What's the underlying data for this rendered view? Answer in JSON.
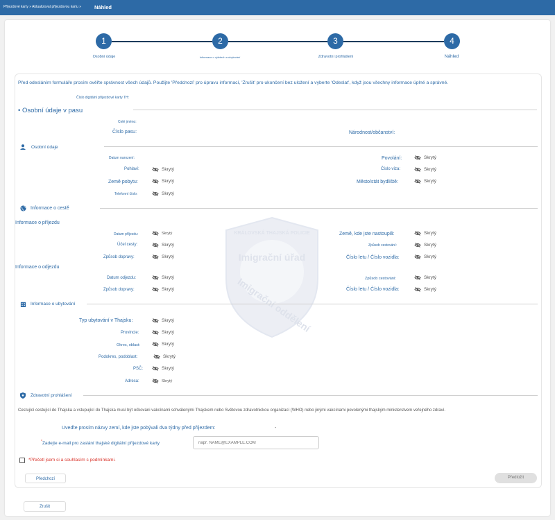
{
  "topbar": {
    "breadcrumb": "Příjezdové karty » Aktualizovat příjezdovou kartu »",
    "title": "Náhled"
  },
  "stepper": {
    "steps": [
      {
        "number": "1",
        "label": "Osobní údaje"
      },
      {
        "number": "2",
        "label": "Informace o výletech a ubytování"
      },
      {
        "number": "3",
        "label": "Zdravotní prohlášení"
      },
      {
        "number": "4",
        "label": "Náhled"
      }
    ]
  },
  "intro": "Před odesláním formuláře prosím ověřte správnost všech údajů. Použijte 'Předchozí' pro úpravu informací, 'Zrušit' pro ukončení bez uložení a vyberte 'Odeslat', když jsou všechny informace úplné a správné.",
  "card_number_label": "Číslo digitální příjezdové karty TH:",
  "passport": {
    "title": "Osobní údaje v pasu",
    "full_name_label": "Celé jméno:",
    "passport_no_label": "Číslo pasu:",
    "nationality_label": "Národnost/občanství:"
  },
  "personal": {
    "title": "Osobní údaje",
    "dob_label": "Datum narození:",
    "occupation_label": "Povolání:",
    "occupation_value": "Skrytý",
    "gender_label": "Pohlaví:",
    "gender_value": "Skrytý",
    "visa_label": "Číslo víza:",
    "visa_value": "Skrytý",
    "residence_country_label": "Země pobytu:",
    "residence_country_value": "Skrytý",
    "residence_city_label": "Město/stát bydliště:",
    "residence_city_value": "Skrytý",
    "phone_label": "Telefonní číslo:",
    "phone_value": "Skrytý"
  },
  "travel": {
    "title": "Informace o cestě",
    "arrival_title": "Informace o příjezdu",
    "arrival_date_label": "Datum příjezdu:",
    "arrival_date_value": "Skrytý",
    "boarded_country_label": "Země, kde jste nastoupili:",
    "boarded_country_value": "Skrytý",
    "purpose_label": "Účel cesty:",
    "purpose_value": "Skrytý",
    "travel_mode_label": "Způsob cestování:",
    "travel_mode_value": "Skrytý",
    "transport_label": "Způsob dopravy:",
    "transport_value": "Skrytý",
    "flight_label": "Číslo letu / Číslo vozidla:",
    "flight_value": "Skrytý",
    "departure_title": "Informace o odjezdu",
    "departure_date_label": "Datum odjezdu:",
    "departure_date_value": "Skrytý",
    "dep_travel_mode_label": "Způsob cestování:",
    "dep_travel_mode_value": "Skrytý",
    "dep_transport_label": "Způsob dopravy:",
    "dep_transport_value": "Skrytý",
    "dep_flight_label": "Číslo letu / Číslo vozidla:",
    "dep_flight_value": "Skrytý"
  },
  "accommodation": {
    "title": "Informace o ubytování",
    "type_label": "Typ ubytování v Thajsku:",
    "type_value": "Skrytý",
    "province_label": "Provincie:",
    "province_value": "Skrytý",
    "district_label": "Okres, oblast:",
    "district_value": "Skrytý",
    "subdistrict_label": "Podokres, podoblast:",
    "subdistrict_value": "Skrytý",
    "zip_label": "PSČ:",
    "zip_value": "Skrytý",
    "address_label": "Adresa:",
    "address_value": "Skrytý"
  },
  "health": {
    "title": "Zdravotní prohlášení",
    "notice": "Cestující cestující do Thajska a vstupující do Thajska musí být očkováni vakcínami schválenými Thajskem nebo Světovou zdravotnickou organizací (WHO) nebo jinými vakcínami povolenými thajským ministerstvem veřejného zdraví.",
    "countries_label": "Uveďte prosím názvy zemí, kde jste pobývali dva týdny před příjezdem:",
    "countries_value": "-",
    "email_label": "Zadejte e-mail pro zaslání thajské digitální příjezdové karty",
    "email_required_mark": "*",
    "email_placeholder": "např. NAME@EXAMPLE.COM",
    "terms_label": "*Přečetl jsem si a souhlasím s podmínkami."
  },
  "watermark": {
    "line1": "KRÁLOVSKÁ THAJSKÁ POLICIE",
    "line2": "Imigrační úřad",
    "line3": "Imigrační oddělení"
  },
  "buttons": {
    "previous": "Předchozí",
    "next": "Předložit",
    "cancel": "Zrušit"
  },
  "colors": {
    "primary": "#2d6aa6",
    "required": "#d9342b"
  }
}
